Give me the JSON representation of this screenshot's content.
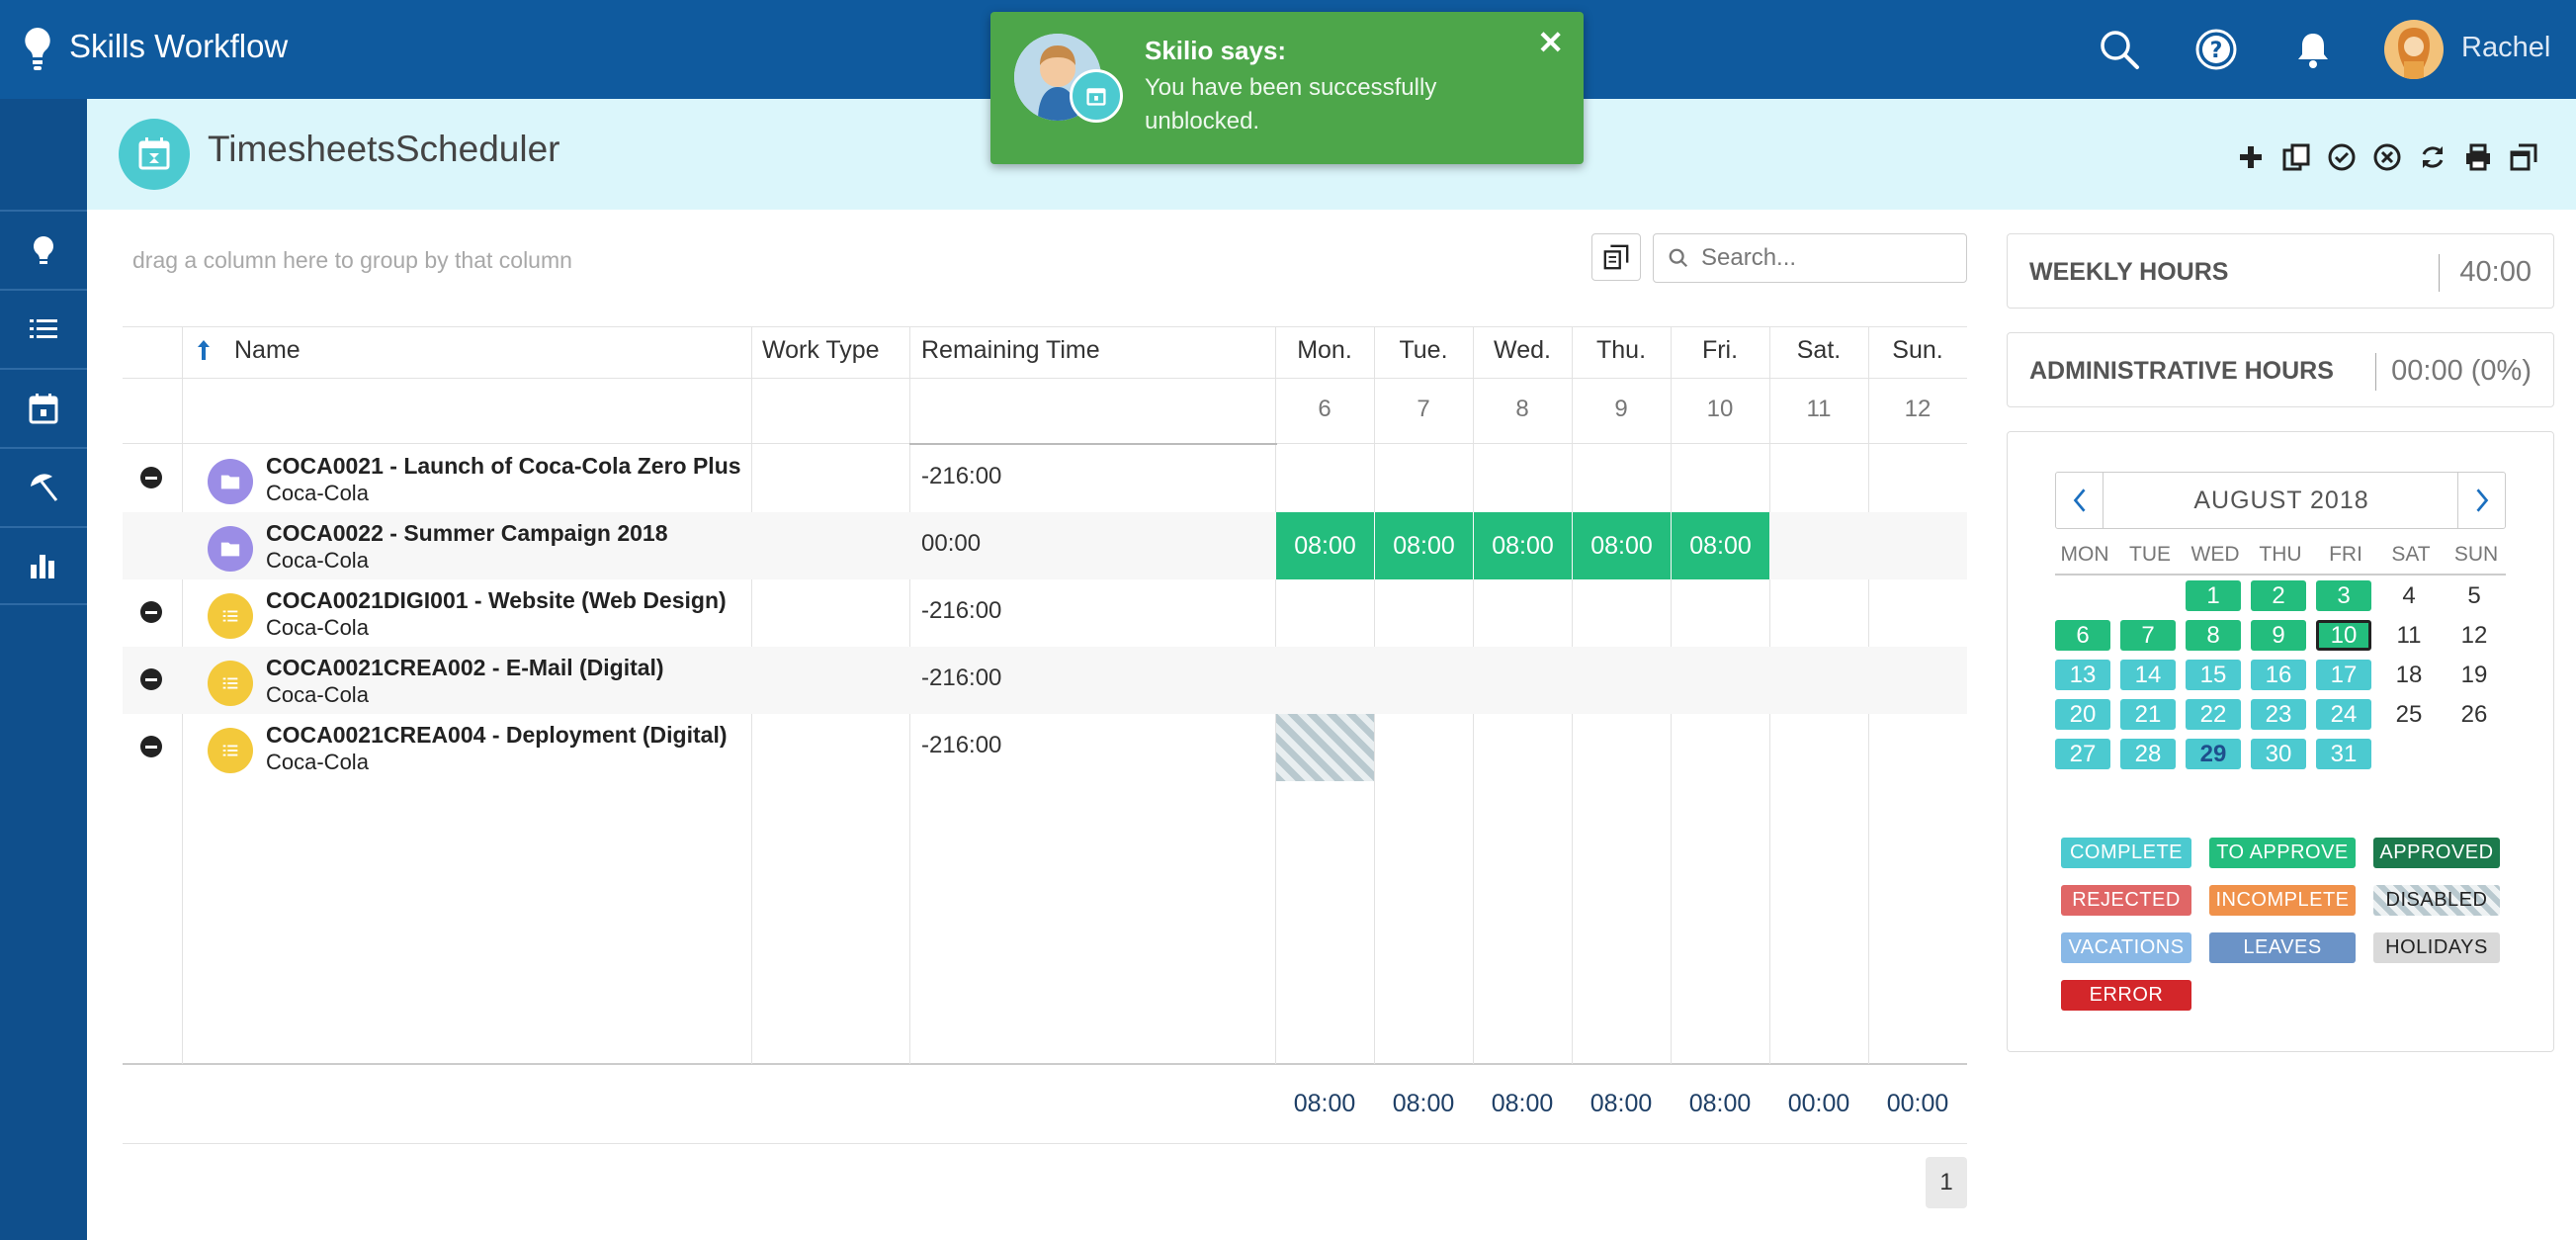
{
  "app": {
    "brand": "Skills Workflow",
    "user_name": "Rachel"
  },
  "page": {
    "title": "TimesheetsScheduler"
  },
  "grid": {
    "group_hint": "drag a column here to group by that column",
    "search_placeholder": "Search...",
    "columns": {
      "name": "Name",
      "work_type": "Work Type",
      "remaining_time": "Remaining Time"
    },
    "days": [
      {
        "label": "Mon.",
        "num": "6"
      },
      {
        "label": "Tue.",
        "num": "7"
      },
      {
        "label": "Wed.",
        "num": "8"
      },
      {
        "label": "Thu.",
        "num": "9"
      },
      {
        "label": "Fri.",
        "num": "10"
      },
      {
        "label": "Sat.",
        "num": "11"
      },
      {
        "label": "Sun.",
        "num": "12"
      }
    ],
    "rows": [
      {
        "name": "COCA0021 - Launch of Coca-Cola Zero Plus",
        "client": "Coca-Cola",
        "remaining": "-216:00",
        "hours": [
          "",
          "",
          "",
          "",
          "",
          "",
          ""
        ]
      },
      {
        "name": "COCA0022 - Summer Campaign 2018",
        "client": "Coca-Cola",
        "remaining": "00:00",
        "hours": [
          "08:00",
          "08:00",
          "08:00",
          "08:00",
          "08:00",
          "",
          ""
        ]
      },
      {
        "name": "COCA0021DIGI001 - Website (Web Design)",
        "client": "Coca-Cola",
        "remaining": "-216:00",
        "hours": [
          "",
          "",
          "",
          "",
          "",
          "",
          ""
        ]
      },
      {
        "name": "COCA0021CREA002 - E-Mail (Digital)",
        "client": "Coca-Cola",
        "remaining": "-216:00",
        "hours": [
          "",
          "",
          "",
          "",
          "",
          "",
          ""
        ]
      },
      {
        "name": "COCA0021CREA004 - Deployment (Digital)",
        "client": "Coca-Cola",
        "remaining": "-216:00",
        "hours": [
          "",
          "",
          "",
          "",
          "",
          "",
          ""
        ]
      }
    ],
    "totals": [
      "08:00",
      "08:00",
      "08:00",
      "08:00",
      "08:00",
      "00:00",
      "00:00"
    ],
    "page_number": "1"
  },
  "summary": {
    "weekly_label": "WEEKLY HOURS",
    "weekly_value": "40:00",
    "admin_label": "ADMINISTRATIVE HOURS",
    "admin_value": "00:00 (0%)"
  },
  "calendar": {
    "month": "AUGUST 2018",
    "dow": [
      "MON",
      "TUE",
      "WED",
      "THU",
      "FRI",
      "SAT",
      "SUN"
    ],
    "weeks": [
      [
        "",
        "",
        "1",
        "2",
        "3",
        "4",
        "5"
      ],
      [
        "6",
        "7",
        "8",
        "9",
        "10",
        "11",
        "12"
      ],
      [
        "13",
        "14",
        "15",
        "16",
        "17",
        "18",
        "19"
      ],
      [
        "20",
        "21",
        "22",
        "23",
        "24",
        "25",
        "26"
      ],
      [
        "27",
        "28",
        "29",
        "30",
        "31",
        "",
        ""
      ]
    ]
  },
  "legend": [
    {
      "label": "COMPLETE",
      "bg": "#4ccad0",
      "fg": "#ffffff"
    },
    {
      "label": "TO APPROVE",
      "bg": "#23bd7d",
      "fg": "#ffffff"
    },
    {
      "label": "APPROVED",
      "bg": "#1b7a4c",
      "fg": "#ffffff"
    },
    {
      "label": "REJECTED",
      "bg": "#e06666",
      "fg": "#ffffff"
    },
    {
      "label": "INCOMPLETE",
      "bg": "#f0914a",
      "fg": "#ffffff"
    },
    {
      "label": "DISABLED",
      "bg": "hatch",
      "fg": "#222222"
    },
    {
      "label": "VACATIONS",
      "bg": "#89b8e6",
      "fg": "#ffffff"
    },
    {
      "label": "LEAVES",
      "bg": "#6b93c7",
      "fg": "#ffffff"
    },
    {
      "label": "HOLIDAYS",
      "bg": "#d9d9d9",
      "fg": "#222222"
    },
    {
      "label": "ERROR",
      "bg": "#d3262a",
      "fg": "#ffffff"
    }
  ],
  "toast": {
    "title": "Skilio says:",
    "message": "You have been successfully unblocked."
  },
  "colors": {
    "topbar": "#0f5a9e",
    "sidebar": "#0f4f8c",
    "header_band": "#dbf6fb",
    "accent": "#4ccad0",
    "green": "#23bd7d",
    "toast": "#4da64a"
  }
}
